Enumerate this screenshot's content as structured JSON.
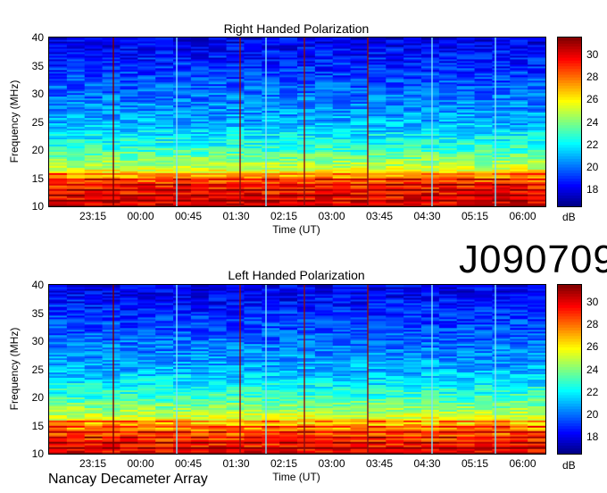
{
  "station_id": "J090709",
  "footer_text": "Nancay Decameter Array",
  "chart_data": [
    {
      "type": "heatmap",
      "title": "Right Handed Polarization",
      "xlabel": "Time (UT)",
      "ylabel": "Frequency (MHz)",
      "x_ticks": [
        "23:15",
        "00:00",
        "00:45",
        "01:30",
        "02:15",
        "03:00",
        "03:45",
        "04:30",
        "05:15",
        "06:00"
      ],
      "y_ticks": [
        10,
        15,
        20,
        25,
        30,
        35,
        40
      ],
      "ylim": [
        10,
        40
      ],
      "colorbar": {
        "label": "dB",
        "ticks": [
          18,
          20,
          22,
          24,
          26,
          28,
          30
        ],
        "range": [
          16.5,
          31.5
        ]
      },
      "intensity_profile": [
        {
          "freq_mhz": 10,
          "db": 30
        },
        {
          "freq_mhz": 14,
          "db": 29
        },
        {
          "freq_mhz": 17,
          "db": 25
        },
        {
          "freq_mhz": 20,
          "db": 23
        },
        {
          "freq_mhz": 25,
          "db": 21
        },
        {
          "freq_mhz": 30,
          "db": 20
        },
        {
          "freq_mhz": 35,
          "db": 19
        },
        {
          "freq_mhz": 40,
          "db": 18
        }
      ]
    },
    {
      "type": "heatmap",
      "title": "Left Handed Polarization",
      "xlabel": "Time (UT)",
      "ylabel": "Frequency (MHz)",
      "x_ticks": [
        "23:15",
        "00:00",
        "00:45",
        "01:30",
        "02:15",
        "03:00",
        "03:45",
        "04:30",
        "05:15",
        "06:00"
      ],
      "y_ticks": [
        10,
        15,
        20,
        25,
        30,
        35,
        40
      ],
      "ylim": [
        10,
        40
      ],
      "colorbar": {
        "label": "dB",
        "ticks": [
          18,
          20,
          22,
          24,
          26,
          28,
          30
        ],
        "range": [
          16.5,
          31.5
        ]
      },
      "intensity_profile": [
        {
          "freq_mhz": 10,
          "db": 30
        },
        {
          "freq_mhz": 14,
          "db": 28
        },
        {
          "freq_mhz": 17,
          "db": 25
        },
        {
          "freq_mhz": 20,
          "db": 23
        },
        {
          "freq_mhz": 25,
          "db": 21
        },
        {
          "freq_mhz": 30,
          "db": 20
        },
        {
          "freq_mhz": 35,
          "db": 19
        },
        {
          "freq_mhz": 40,
          "db": 18
        }
      ]
    }
  ]
}
